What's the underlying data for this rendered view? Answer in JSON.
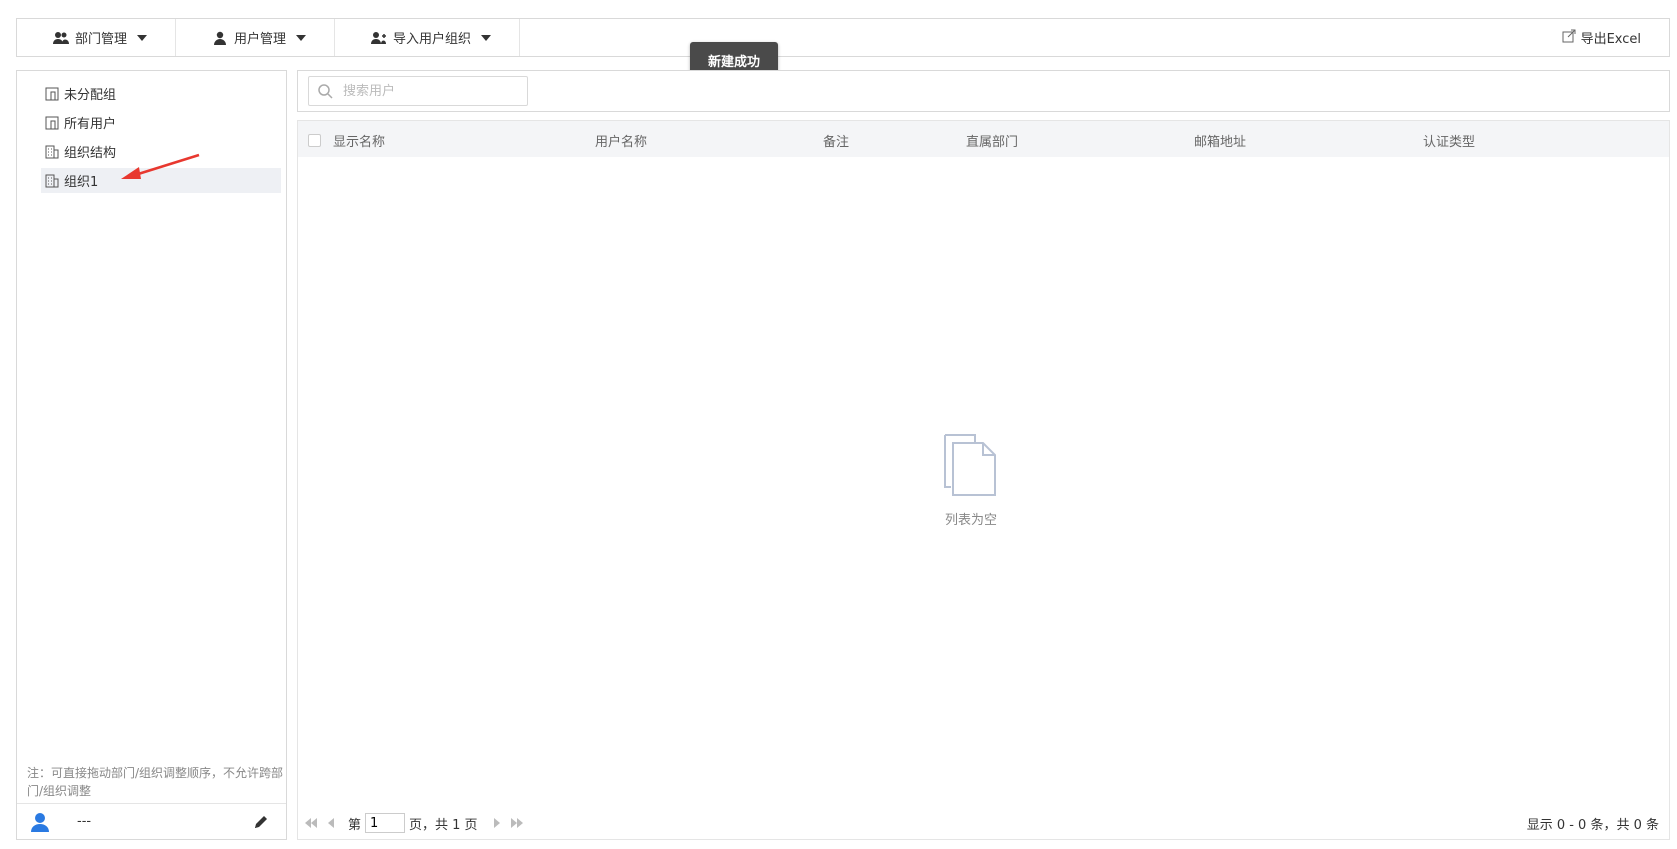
{
  "toolbar": {
    "dept_manage": "部门管理",
    "user_manage": "用户管理",
    "import_org": "导入用户组织",
    "export_excel": "导出Excel"
  },
  "toast": "新建成功",
  "tree": {
    "items": [
      {
        "label": "未分配组",
        "icon": "group-icon"
      },
      {
        "label": "所有用户",
        "icon": "group-icon"
      },
      {
        "label": "组织结构",
        "icon": "building-icon"
      },
      {
        "label": "组织1",
        "icon": "building-icon",
        "selected": true
      }
    ]
  },
  "note": "注：可直接拖动部门/组织调整顺序，不允许跨部门/组织调整",
  "current_user": "---",
  "search": {
    "placeholder": "搜索用户"
  },
  "grid": {
    "columns": [
      "显示名称",
      "用户名称",
      "备注",
      "直属部门",
      "邮箱地址",
      "认证类型"
    ],
    "empty_text": "列表为空"
  },
  "pager": {
    "page_prefix": "第",
    "page_value": "1",
    "page_suffix": "页，共 1 页",
    "summary": "显示 0 - 0 条，共 0 条"
  },
  "colors": {
    "toast_bg": "#4a4a4a",
    "selected_bg": "#eef0f4",
    "header_bg": "#f4f5f7",
    "avatar": "#2a7ae2"
  }
}
